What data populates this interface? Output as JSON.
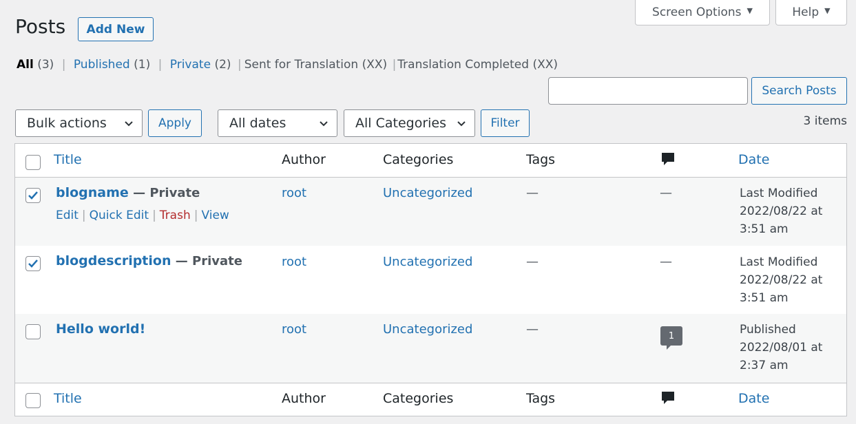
{
  "screen_meta": {
    "screen_options_label": "Screen Options",
    "help_label": "Help",
    "arrow": "▼"
  },
  "header": {
    "title": "Posts",
    "add_new_label": "Add New"
  },
  "views": {
    "all_label": "All",
    "all_count": "(3)",
    "published_label": "Published",
    "published_count": "(1)",
    "private_label": "Private",
    "private_count": "(2)",
    "sent_label": "Sent for Translation (XX)",
    "completed_label": "Translation Completed (XX)",
    "separator": "|"
  },
  "search": {
    "value": "",
    "button_label": "Search Posts"
  },
  "filters": {
    "bulk_actions": "Bulk actions",
    "apply_label": "Apply",
    "dates": "All dates",
    "categories": "All Categories",
    "filter_label": "Filter",
    "items_count": "3 items"
  },
  "table": {
    "columns": {
      "title": "Title",
      "author": "Author",
      "categories": "Categories",
      "tags": "Tags",
      "date": "Date"
    },
    "rows": [
      {
        "checked": true,
        "title": "blogname",
        "state": " — Private",
        "author": "root",
        "categories": "Uncategorized",
        "tags": "—",
        "comments": "—",
        "date_status": "Last Modified",
        "date_line": "2022/08/22 at",
        "time": "3:51 am"
      },
      {
        "checked": true,
        "title": "blogdescription",
        "state": " — Private",
        "author": "root",
        "categories": "Uncategorized",
        "tags": "—",
        "comments": "—",
        "date_status": "Last Modified",
        "date_line": "2022/08/22 at",
        "time": "3:51 am"
      },
      {
        "checked": false,
        "title": "Hello world!",
        "state": "",
        "author": "root",
        "categories": "Uncategorized",
        "tags": "—",
        "comments": "1",
        "date_status": "Published",
        "date_line": "2022/08/01 at",
        "time": "2:37 am"
      }
    ],
    "row_actions": {
      "edit": "Edit",
      "quick_edit": "Quick Edit",
      "trash": "Trash",
      "view": "View",
      "separator": "|"
    }
  },
  "colors": {
    "link": "#2271b1",
    "trash": "#b32d2e",
    "checkbox_check": "#2271b1",
    "comment_bubble": "#646970"
  }
}
